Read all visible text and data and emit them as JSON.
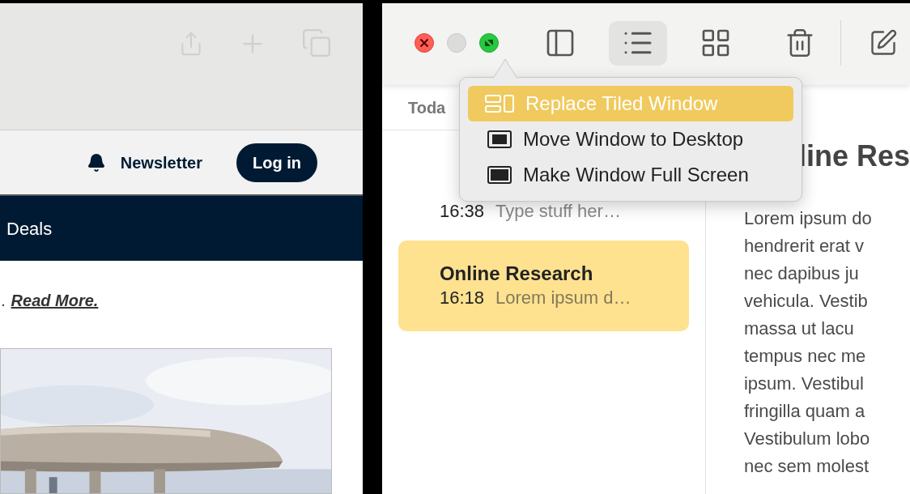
{
  "browser": {
    "newsletter": "Newsletter",
    "login": "Log in",
    "nav_items": [
      "Deals"
    ],
    "teaser": {
      "text": ".",
      "link": "Read More."
    },
    "picture": {
      "kind": "picture"
    }
  },
  "notes": {
    "view_buttons": [
      {
        "kind": "sidebar",
        "selected": false
      },
      {
        "kind": "list",
        "selected": true
      },
      {
        "kind": "gallery",
        "selected": false
      }
    ],
    "section_header": "Toda",
    "list": [
      {
        "time": "16:38",
        "preview": "Type stuff her…",
        "selected": false
      },
      {
        "title": "Online Research",
        "time": "16:18",
        "preview": "Lorem ipsum d…",
        "selected": true
      }
    ],
    "editor": {
      "title": "line Res",
      "lines": [
        "Lorem ipsum do",
        "hendrerit erat v",
        "nec dapibus ju",
        "vehicula. Vestib",
        "massa ut lacu",
        "tempus nec me",
        "ipsum. Vestibul",
        "fringilla quam a",
        "Vestibulum lobo",
        "nec sem molest"
      ]
    },
    "popup": {
      "items": [
        {
          "kind": "tile",
          "label": "Replace Tiled Window",
          "selected": true
        },
        {
          "kind": "desktop",
          "label": "Move Window to Desktop",
          "selected": false
        },
        {
          "kind": "fullscreen",
          "label": "Make Window Full Screen",
          "selected": false
        }
      ]
    }
  }
}
